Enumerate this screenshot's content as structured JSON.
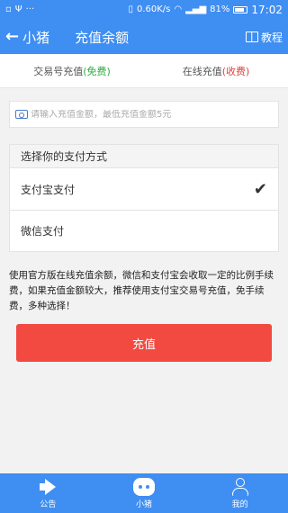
{
  "status_bar": {
    "speed": "0.60K/s",
    "battery": "81%",
    "time": "17:02"
  },
  "app_bar": {
    "back_label": "小猪",
    "title": "充值余额",
    "tutorial_label": "教程"
  },
  "tabs": {
    "items": [
      {
        "label": "交易号充值",
        "tag": "(免费)"
      },
      {
        "label": "在线充值",
        "tag": "(收费)"
      }
    ]
  },
  "amount": {
    "placeholder": "请输入充值金额，最低充值金额5元",
    "value": ""
  },
  "payment": {
    "header": "选择你的支付方式",
    "options": [
      {
        "label": "支付宝支付",
        "selected": true
      },
      {
        "label": "微信支付",
        "selected": false
      }
    ]
  },
  "note": "使用官方版在线充值余额，微信和支付宝会收取一定的比例手续费，如果充值金额较大，推荐使用支付宝交易号充值，免手续费，多种选择！",
  "recharge_button": "充值",
  "bottom_nav": {
    "items": [
      {
        "label": "公告",
        "icon": "megaphone-icon"
      },
      {
        "label": "小猪",
        "icon": "pig-icon"
      },
      {
        "label": "我的",
        "icon": "person-icon"
      }
    ]
  },
  "colors": {
    "primary": "#3f8ef2",
    "button": "#f24a41",
    "free": "#2eaa41",
    "fee": "#e0443a"
  }
}
